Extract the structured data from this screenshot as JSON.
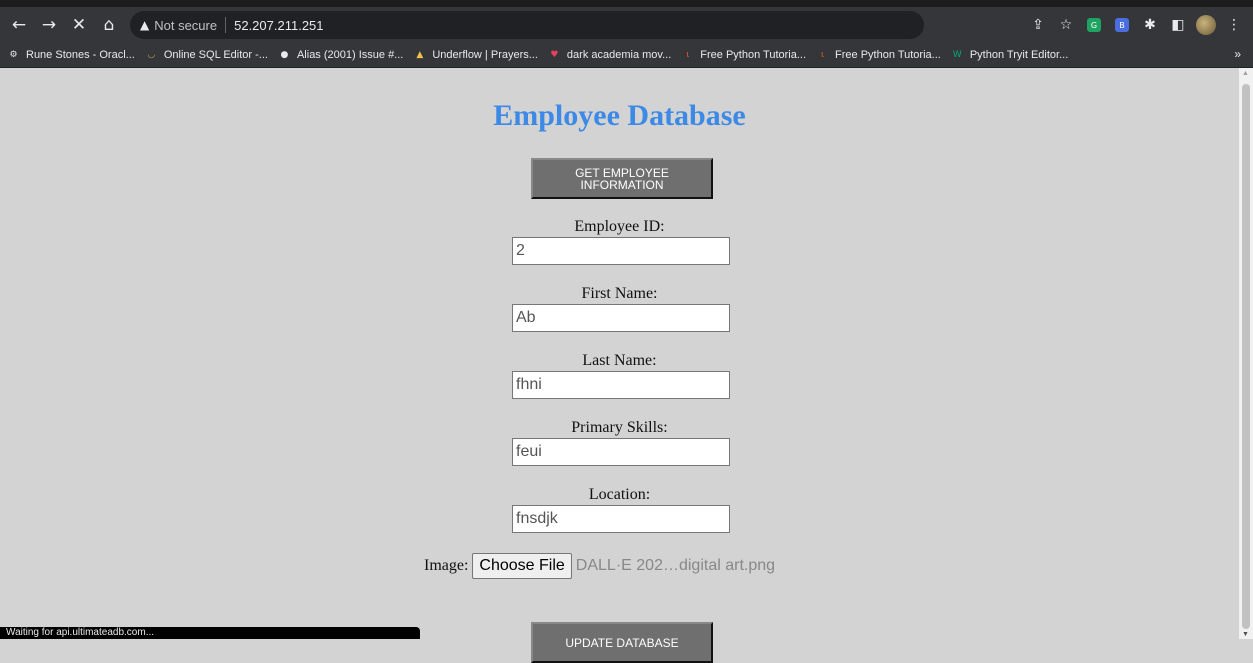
{
  "browser": {
    "nav": {
      "back": "←",
      "forward": "→",
      "stop": "✕",
      "home": "⌂"
    },
    "security_label": "Not secure",
    "url": "52.207.211.251",
    "bookmarks": [
      {
        "label": "Rune Stones - Oracl...",
        "icon": "gear-icon",
        "glyph": "⚙",
        "color": "#e8eaed"
      },
      {
        "label": "Online SQL Editor -...",
        "icon": "sql-icon",
        "glyph": "◡",
        "color": "#c9a94a"
      },
      {
        "label": "Alias (2001) Issue #...",
        "icon": "github-icon",
        "glyph": "●",
        "color": "#e8eaed"
      },
      {
        "label": "Underflow | Prayers...",
        "icon": "underflow-icon",
        "glyph": "▲",
        "color": "#f0c14b"
      },
      {
        "label": "dark academia mov...",
        "icon": "heart-icon",
        "glyph": "♥",
        "color": "#e5415f"
      },
      {
        "label": "Free Python Tutoria...",
        "icon": "tutorial-icon",
        "glyph": "ɩ",
        "color": "#e4572e"
      },
      {
        "label": "Free Python Tutoria...",
        "icon": "tutorial-icon",
        "glyph": "ɩ",
        "color": "#e4572e"
      },
      {
        "label": "Python Tryit Editor...",
        "icon": "w3schools-icon",
        "glyph": "W",
        "color": "#04aa6d"
      }
    ],
    "bookmarks_more": "»",
    "status": "Waiting for api.ultimateadb.com..."
  },
  "page": {
    "title": "Employee Database",
    "get_button": "GET EMPLOYEE INFORMATION",
    "fields": {
      "employee_id": {
        "label": "Employee ID:",
        "value": "2"
      },
      "first_name": {
        "label": "First Name:",
        "value": "Ab"
      },
      "last_name": {
        "label": "Last Name:",
        "value": "fhni"
      },
      "primary_skills": {
        "label": "Primary Skills:",
        "value": "feui"
      },
      "location": {
        "label": "Location:",
        "value": "fnsdjk"
      }
    },
    "image": {
      "label": "Image:",
      "button": "Choose File",
      "file": "DALL·E 202…digital art.png"
    },
    "update_button": "UPDATE DATABASE"
  }
}
